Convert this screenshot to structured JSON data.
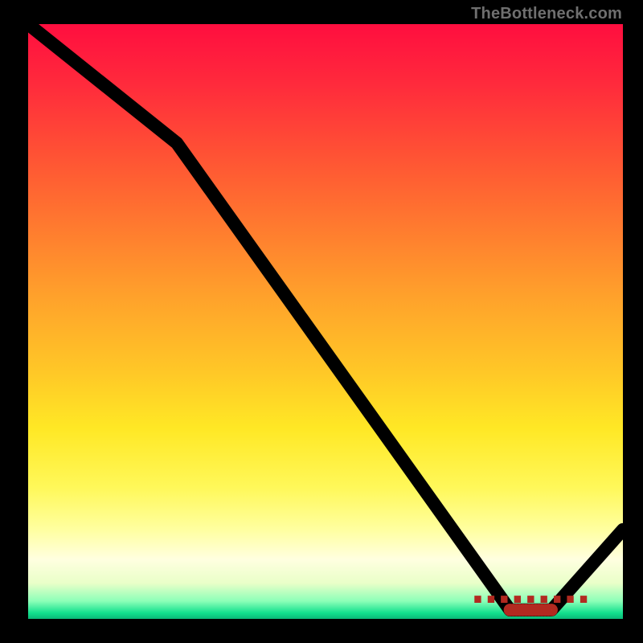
{
  "watermark": "TheBottleneck.com",
  "chart_data": {
    "type": "line",
    "title": "",
    "xlabel": "",
    "ylabel": "",
    "xlim": [
      0,
      100
    ],
    "ylim": [
      0,
      100
    ],
    "grid": false,
    "series": [
      {
        "name": "curve",
        "x": [
          0,
          25,
          81,
          88,
          100
        ],
        "values": [
          100,
          80,
          1.5,
          1.5,
          15
        ]
      }
    ],
    "marker_cluster": {
      "y": 1.5,
      "x_start": 81,
      "x_end": 88,
      "count": 14,
      "label": "........."
    },
    "background_gradient": {
      "top": "#ff0e3f",
      "mid": "#ffe825",
      "bottom": "#12e08d"
    },
    "colors": {
      "line": "#000000",
      "markers": "#e73b2f",
      "watermark": "#6f6f6f",
      "frame": "#000000"
    }
  }
}
